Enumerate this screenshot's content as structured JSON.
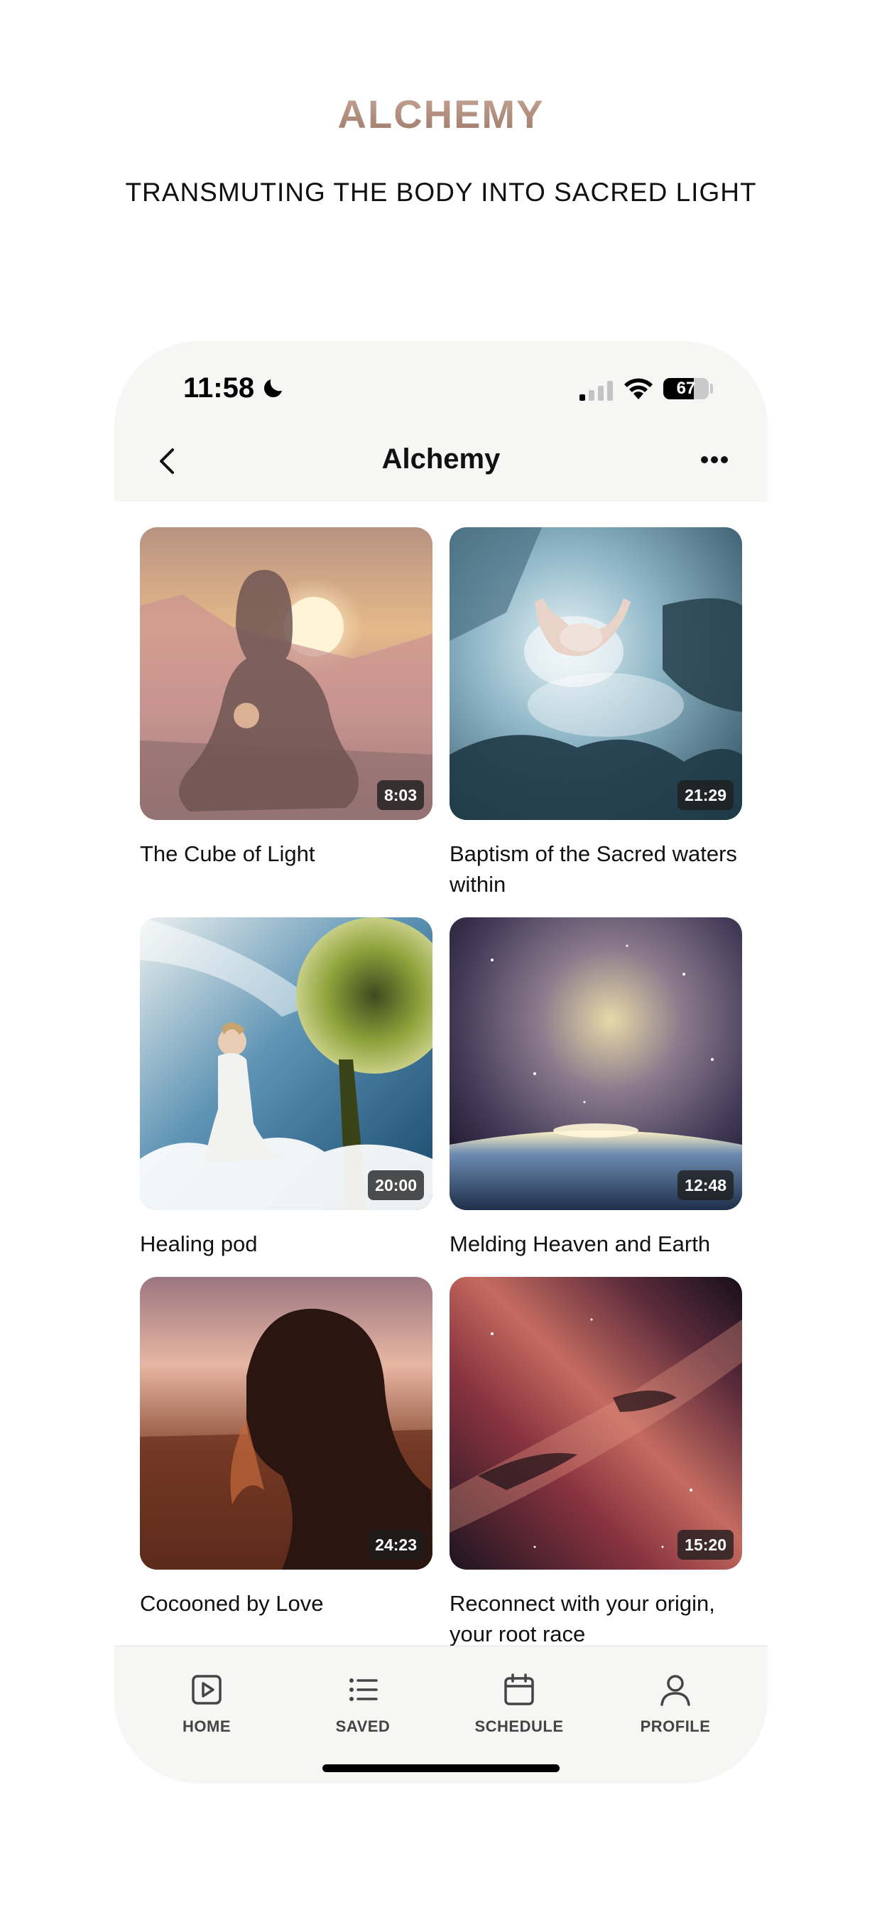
{
  "header": {
    "brand": "ALCHEMY",
    "tagline": "TRANSMUTING THE BODY INTO SACRED LIGHT"
  },
  "status_bar": {
    "time": "11:58",
    "battery": "67",
    "battery_level": 0.67,
    "icons": [
      "moon-icon",
      "signal-icon",
      "wifi-icon",
      "battery-icon"
    ]
  },
  "nav": {
    "title": "Alchemy",
    "back_icon": "chevron-left-icon",
    "more_icon": "more-horizontal-icon"
  },
  "cards": [
    {
      "title": "The Cube of Light",
      "duration": "8:03"
    },
    {
      "title": "Baptism of the Sacred waters within",
      "duration": "21:29"
    },
    {
      "title": "Healing pod",
      "duration": "20:00"
    },
    {
      "title": "Melding Heaven and Earth",
      "duration": "12:48"
    },
    {
      "title": "Cocooned by Love",
      "duration": "24:23"
    },
    {
      "title": "Reconnect with your origin, your root race",
      "duration": "15:20"
    }
  ],
  "tabs": [
    {
      "label": "HOME",
      "icon": "play-square-icon"
    },
    {
      "label": "SAVED",
      "icon": "list-icon"
    },
    {
      "label": "SCHEDULE",
      "icon": "calendar-icon"
    },
    {
      "label": "PROFILE",
      "icon": "user-icon"
    }
  ],
  "colors": {
    "brand_gradient_top": "#c9a899",
    "brand_gradient_bottom": "#9c7867",
    "phone_background": "#f6f6f4",
    "tab_label": "#444444"
  }
}
